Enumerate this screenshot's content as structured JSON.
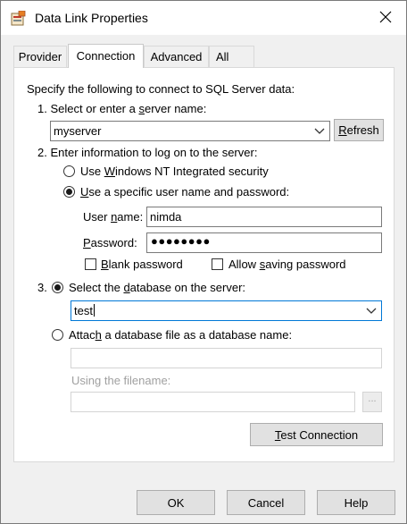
{
  "window": {
    "title": "Data Link Properties"
  },
  "tabs": [
    {
      "label": "Provider"
    },
    {
      "label": "Connection"
    },
    {
      "label": "Advanced"
    },
    {
      "label": "All"
    }
  ],
  "connection": {
    "intro": "Specify the following to connect to SQL Server data:",
    "step1": {
      "number": "1.",
      "label_pre": "Select or enter a ",
      "label_u": "s",
      "label_post": "erver name:",
      "server_value": "myserver",
      "refresh_label_u": "R",
      "refresh_label_post": "efresh"
    },
    "step2": {
      "number": "2.",
      "label": "Enter information to log on to the server:",
      "radio_windows": {
        "pre": "Use ",
        "u": "W",
        "post": "indows NT Integrated security",
        "selected": false
      },
      "radio_specific": {
        "pre": "",
        "u": "U",
        "post": "se a specific user name and password:",
        "selected": true
      },
      "user_name_label": {
        "pre": "User ",
        "u": "n",
        "post": "ame:"
      },
      "user_name_value": "nimda",
      "password_label": {
        "pre": "",
        "u": "P",
        "post": "assword:"
      },
      "password_mask": "●●●●●●●●",
      "blank_password": {
        "pre": "",
        "u": "B",
        "post": "lank password",
        "checked": false
      },
      "allow_saving": {
        "pre": "Allow ",
        "u": "s",
        "post": "aving password",
        "checked": false
      }
    },
    "step3": {
      "number": "3.",
      "radio_select_db": {
        "pre": "Select the ",
        "u": "d",
        "post": "atabase on the server:",
        "selected": true
      },
      "database_value": "test",
      "radio_attach": {
        "pre": "Attac",
        "u": "h",
        "post": " a database file as a database name:",
        "selected": false
      },
      "attach_value": "",
      "filename_label": "Using the filename:",
      "filename_value": "",
      "browse_label": "..."
    },
    "test_connection": {
      "u": "T",
      "post": "est Connection"
    }
  },
  "footer": {
    "ok_label": "OK",
    "cancel_label": "Cancel",
    "help_label": "Help"
  },
  "colors": {
    "accent": "#0078d7",
    "window_bg": "#f0f0f0",
    "button_bg": "#e1e1e1"
  }
}
